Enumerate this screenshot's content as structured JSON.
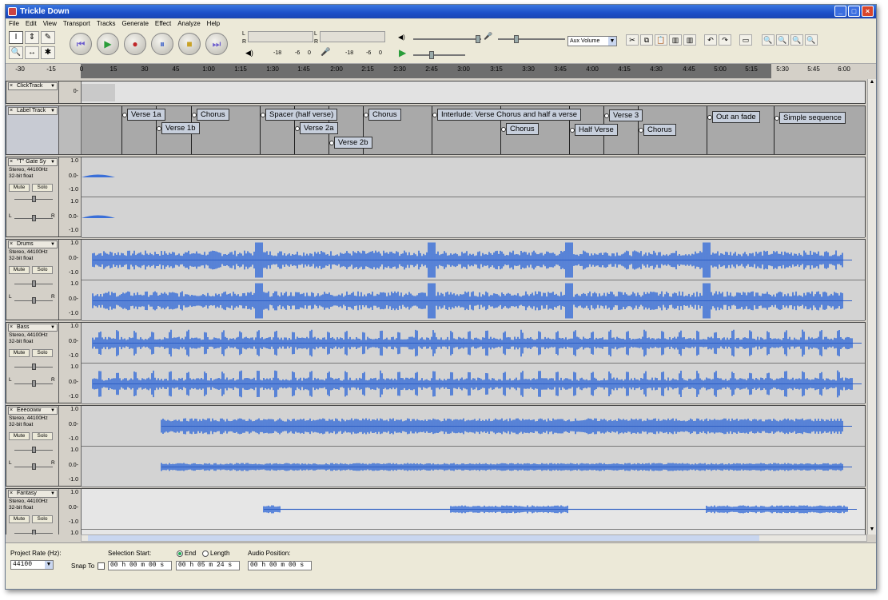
{
  "window": {
    "title": "Trickle Down",
    "min": "_",
    "max": "□",
    "close": "×"
  },
  "menu": [
    "File",
    "Edit",
    "View",
    "Transport",
    "Tracks",
    "Generate",
    "Effect",
    "Analyze",
    "Help"
  ],
  "tools": [
    "I",
    "⇕",
    "✎",
    "🔍",
    "↔",
    "✱"
  ],
  "transport": {
    "rewind": "⏮",
    "play": "▶",
    "record": "●",
    "pause": "⏸",
    "stop": "■",
    "ffwd": "⏭"
  },
  "meters": {
    "L": "L",
    "R": "R",
    "ticks_play": [
      "-18",
      "-6",
      "0"
    ],
    "ticks_rec": [
      "-18",
      "-6",
      "0"
    ]
  },
  "mixer": {
    "input_device": "Aux Volume",
    "dd": "▼"
  },
  "edit_icons": [
    "✂",
    "⧉",
    "📋",
    "▥",
    "▥",
    "↶",
    "↷",
    "▭",
    "🔍",
    "🔍",
    "🔍",
    "🔍"
  ],
  "ruler": {
    "ticks": [
      "-30",
      "-15",
      "0",
      "15",
      "30",
      "45",
      "1:00",
      "1:15",
      "1:30",
      "1:45",
      "2:00",
      "2:15",
      "2:30",
      "2:45",
      "3:00",
      "3:15",
      "3:30",
      "3:45",
      "4:00",
      "4:15",
      "4:30",
      "4:45",
      "5:00",
      "5:15",
      "5:30",
      "5:45",
      "6:00"
    ]
  },
  "tracks": {
    "click": {
      "name": "ClickTrack",
      "scale": "0-"
    },
    "label": {
      "name": "Label Track"
    },
    "gate": {
      "name": "\"T\" Gate Sy",
      "fmt1": "Stereo, 44100Hz",
      "fmt2": "32-bit float",
      "mute": "Mute",
      "solo": "Solo"
    },
    "drums": {
      "name": "Drums",
      "fmt1": "Stereo, 44100Hz",
      "fmt2": "32-bit float",
      "mute": "Mute",
      "solo": "Solo"
    },
    "bass": {
      "name": "Bass",
      "fmt1": "Stereo, 44100Hz",
      "fmt2": "32-bit float",
      "mute": "Mute",
      "solo": "Solo"
    },
    "eeeoo": {
      "name": "Eeeooww",
      "fmt1": "Stereo, 44100Hz",
      "fmt2": "32-bit float",
      "mute": "Mute",
      "solo": "Solo"
    },
    "fantasy": {
      "name": "Fantasy",
      "fmt1": "Stereo, 44100Hz",
      "fmt2": "32-bit float",
      "mute": "Mute",
      "solo": "Solo"
    }
  },
  "scale": {
    "top": "1.0",
    "mid": "0.0-",
    "bot": "-1.0"
  },
  "pan": {
    "L": "L",
    "R": "R"
  },
  "labels": [
    "Verse 1a",
    "Verse 1b",
    "Chorus",
    "Spacer (half verse)",
    "Verse 2a",
    "Verse 2b",
    "Chorus",
    "Interlude: Verse Chorus and half a verse",
    "Chorus",
    "Verse 3",
    "Half Verse",
    "Chorus",
    "Out an fade",
    "Simple sequence"
  ],
  "status": {
    "project_rate_label": "Project Rate (Hz):",
    "project_rate": "44100",
    "snap_to": "Snap To",
    "selection_start_label": "Selection Start:",
    "end_label": "End",
    "length_label": "Length",
    "audio_position_label": "Audio Position:",
    "sel_start": "00 h 00 m 00 s",
    "sel_end": "00 h 05 m 24 s",
    "audio_pos": "00 h 00 m 00 s"
  }
}
